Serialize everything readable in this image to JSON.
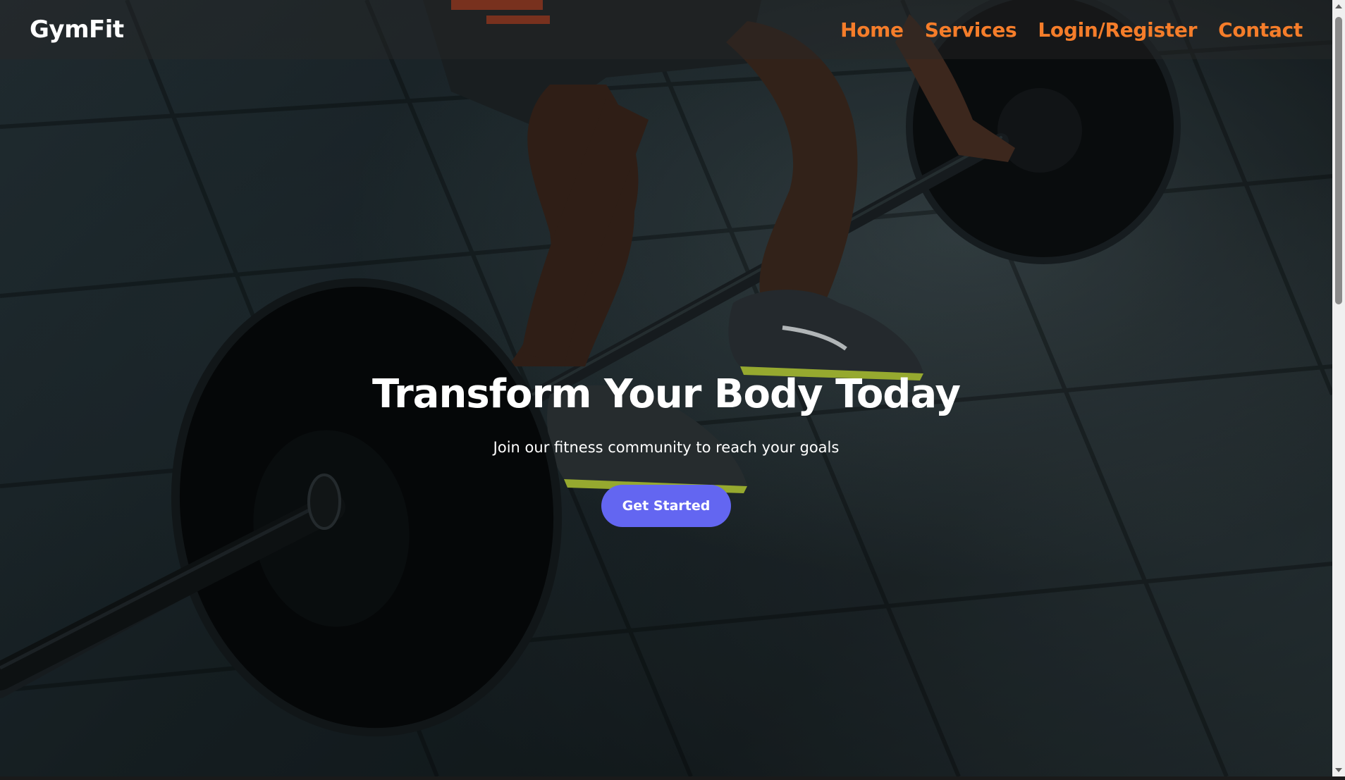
{
  "header": {
    "logo": "GymFit",
    "nav": [
      {
        "label": "Home"
      },
      {
        "label": "Services"
      },
      {
        "label": "Login/Register"
      },
      {
        "label": "Contact"
      }
    ]
  },
  "hero": {
    "title": "Transform Your Body Today",
    "subtitle": "Join our fitness community to reach your goals",
    "cta_label": "Get Started",
    "background_image": "weightlifter-deadlift-barbell-photo"
  },
  "colors": {
    "nav_link": "#f57d2a",
    "cta_background": "#6366f1",
    "text": "#ffffff"
  }
}
